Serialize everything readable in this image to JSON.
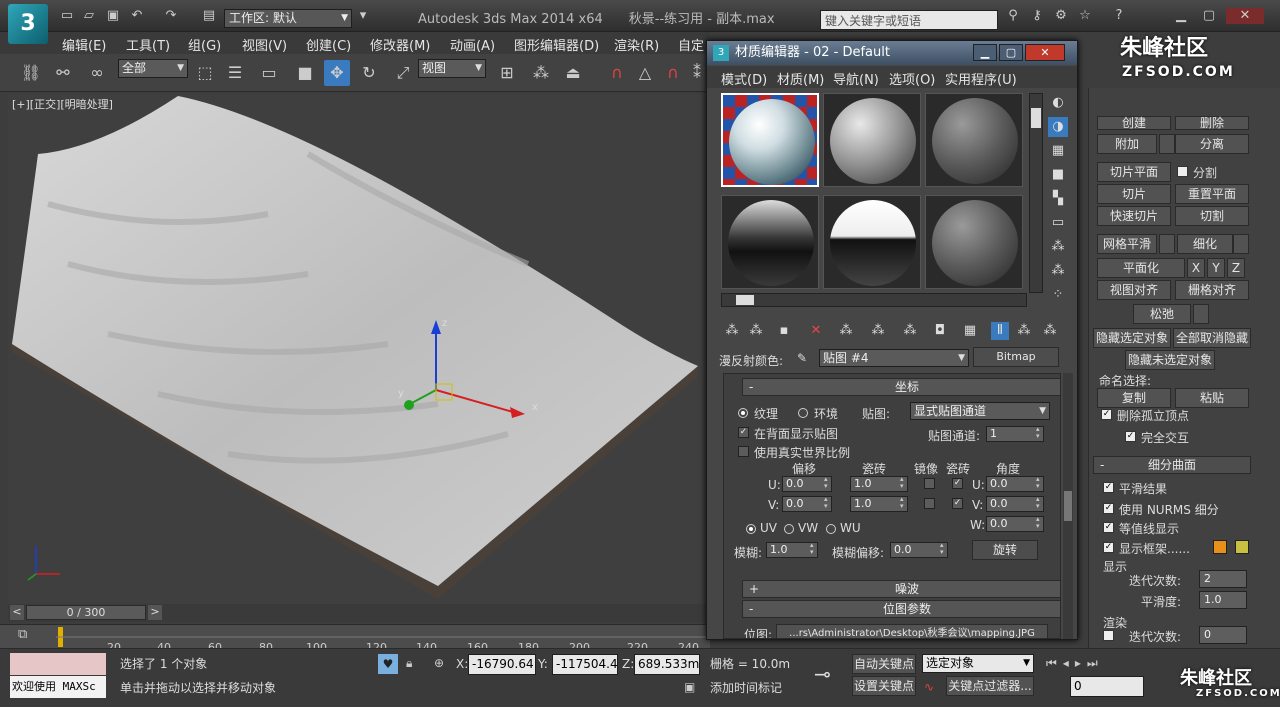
{
  "app": {
    "title": "Autodesk 3ds Max  2014 x64",
    "file": "秋景--练习用 - 副本.max",
    "workspace": "工作区: 默认",
    "search_placeholder": "键入关键字或短语"
  },
  "menubar": [
    "编辑(E)",
    "工具(T)",
    "组(G)",
    "视图(V)",
    "创建(C)",
    "修改器(M)",
    "动画(A)",
    "图形编辑器(D)",
    "渲染(R)",
    "自定"
  ],
  "toolbar": {
    "selection_filter": "全部",
    "ref_coord": "视图"
  },
  "viewport": {
    "label": "[+][正交][明暗处理]"
  },
  "gizmo": {
    "x": "x",
    "y": "y",
    "z": "z"
  },
  "timeslider": {
    "frame": "0 / 300",
    "prev": "<",
    "next": ">"
  },
  "ruler": [
    "20",
    "40",
    "60",
    "80",
    "100",
    "120",
    "140",
    "160",
    "180",
    "200",
    "220",
    "240"
  ],
  "status": {
    "welcome": "欢迎使用 MAXSc",
    "selected": "选择了 1 个对象",
    "prompt": "单击并拖动以选择并移动对象",
    "x_label": "X:",
    "x": "-16790.64",
    "y_label": "Y:",
    "y": "-117504.4",
    "z_label": "Z:",
    "z": "689.533m",
    "grid": "栅格 = 10.0m",
    "add_tag": "添加时间标记",
    "auto_key": "自动关键点",
    "set_key": "设置关键点",
    "selected_set": "选定对象",
    "key_filters": "关键点过滤器...",
    "frame_field": "0"
  },
  "material_editor": {
    "title": "材质编辑器 - 02 - Default",
    "menu": [
      "模式(D)",
      "材质(M)",
      "导航(N)",
      "选项(O)",
      "实用程序(U)"
    ],
    "diffuse_label": "漫反射颜色:",
    "map_name": "贴图 #4",
    "map_type": "Bitmap",
    "coords_rollout": "坐标",
    "coords_sign": "-",
    "texture": "纹理",
    "environ": "环境",
    "mapping_label": "贴图:",
    "mapping_value": "显式贴图通道",
    "show_back": "在背面显示贴图",
    "map_channel_label": "贴图通道:",
    "map_channel": "1",
    "real_world": "使用真实世界比例",
    "offset": "偏移",
    "tiling": "瓷砖",
    "mirror": "镜像",
    "tile": "瓷砖",
    "angle": "角度",
    "u_label": "U:",
    "v_label": "V:",
    "w_label": "W:",
    "u_offset": "0.0",
    "v_offset": "0.0",
    "u_tiling": "1.0",
    "v_tiling": "1.0",
    "u_angle": "0.0",
    "v_angle": "0.0",
    "w_angle": "0.0",
    "uv": "UV",
    "vw": "VW",
    "wu": "WU",
    "blur_label": "模糊:",
    "blur": "1.0",
    "blur_offset_label": "模糊偏移:",
    "blur_offset": "0.0",
    "rotate": "旋转",
    "noise_rollout": "噪波",
    "noise_sign": "+",
    "bitmap_rollout": "位图参数",
    "bitmap_sign": "-",
    "bitmap_label": "位图:",
    "bitmap_path": "...rs\\Administrator\\Desktop\\秋季会议\\mapping.JPG"
  },
  "command_panel": {
    "create": "创建",
    "remove": "删除",
    "attach": "附加",
    "detach": "分离",
    "slice_plane": "切片平面",
    "split": "分割",
    "slice": "切片",
    "reset_plane": "重置平面",
    "quick_slice": "快速切片",
    "cut": "切割",
    "meshsmooth": "网格平滑",
    "refine": "细化",
    "planarize": "平面化",
    "px": "X",
    "py": "Y",
    "pz": "Z",
    "view_align": "视图对齐",
    "grid_align": "栅格对齐",
    "relax": "松弛",
    "hide_sel": "隐藏选定对象",
    "unhide_all": "全部取消隐藏",
    "hide_unsel": "隐藏未选定对象",
    "named_sel": "命名选择:",
    "copy": "复制",
    "paste": "粘贴",
    "del_iso": "删除孤立顶点",
    "full_inter": "完全交互",
    "subdiv_sign": "-",
    "subdiv": "细分曲面",
    "smooth_result": "平滑结果",
    "nurms": "使用 NURMS 细分",
    "isoline": "等值线显示",
    "show_cage": "显示框架......",
    "display": "显示",
    "iter_label": "迭代次数:",
    "iter": "2",
    "smooth_label": "平滑度:",
    "smooth": "1.0",
    "render": "渲染",
    "iter2": "0"
  },
  "watermark": {
    "top": "朱峰社区",
    "url_top": "ZFSOD.COM",
    "bottom": "朱峰社区",
    "url_bottom": "ZFSOD.COM"
  },
  "colors": {
    "accent": "#2fa7b8",
    "cage1": "#e8901a",
    "cage2": "#c8c040"
  }
}
